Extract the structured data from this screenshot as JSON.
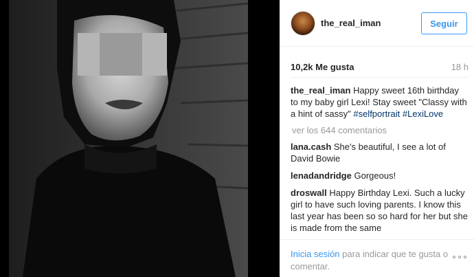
{
  "post": {
    "image_description": "black and white selfie portrait with blurred eyes"
  },
  "header": {
    "username": "the_real_iman",
    "follow_label": "Seguir"
  },
  "stats": {
    "likes": "10,2k Me gusta",
    "time_ago": "18 h"
  },
  "caption": {
    "author": "the_real_iman",
    "text": "Happy sweet 16th birthday to my baby girl Lexi! Stay sweet \"Classy with a hint of sassy\"",
    "tags": "#selfportrait #LexiLove"
  },
  "comments": {
    "view_all": "ver los 644 comentarios",
    "items": [
      {
        "author": "lana.cash",
        "text": "She's beautiful, I see a lot of David Bowie"
      },
      {
        "author": "lenadandridge",
        "text": "Gorgeous!"
      },
      {
        "author": "droswall",
        "text": "Happy Birthday Lexi. Such a lucky girl to have such loving parents. I know this last year has been so so hard for her but she is made from the same"
      }
    ]
  },
  "footer": {
    "login_link": "Inicia sesión",
    "login_text": " para indicar que te gusta o comentar."
  },
  "icons": {
    "more": "more-options-icon"
  }
}
